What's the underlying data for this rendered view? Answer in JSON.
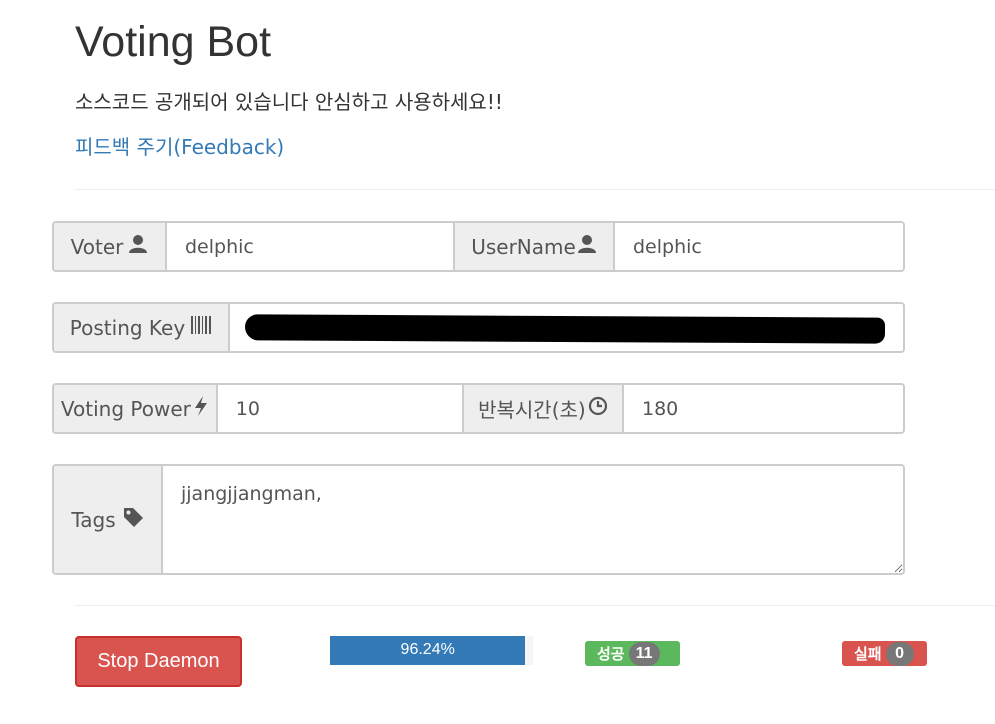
{
  "header": {
    "title": "Voting Bot",
    "subtitle": "소스코드 공개되어 있습니다 안심하고 사용하세요!!",
    "feedback_link": "피드백 주기(Feedback)"
  },
  "form": {
    "voter": {
      "label": "Voter",
      "icon": "user-icon",
      "value": "delphic"
    },
    "username": {
      "label": "UserName",
      "icon": "user-icon",
      "value": "delphic"
    },
    "posting_key": {
      "label": "Posting Key",
      "icon": "barcode-icon",
      "value": ""
    },
    "voting_power": {
      "label": "Voting Power",
      "icon": "flash-icon",
      "value": "10"
    },
    "repeat_time": {
      "label": "반복시간(초)",
      "icon": "clock-icon",
      "value": "180"
    },
    "tags": {
      "label": "Tags",
      "icon": "tag-icon",
      "value": "jjangjjangman,"
    }
  },
  "controls": {
    "stop_button": "Stop Daemon",
    "progress": {
      "value": 96.24,
      "label": "96.24%",
      "color": "#337ab7"
    },
    "success": {
      "label": "성공",
      "count": "11",
      "color": "#5cb85c"
    },
    "fail": {
      "label": "실패",
      "count": "0",
      "color": "#d9534f"
    }
  }
}
